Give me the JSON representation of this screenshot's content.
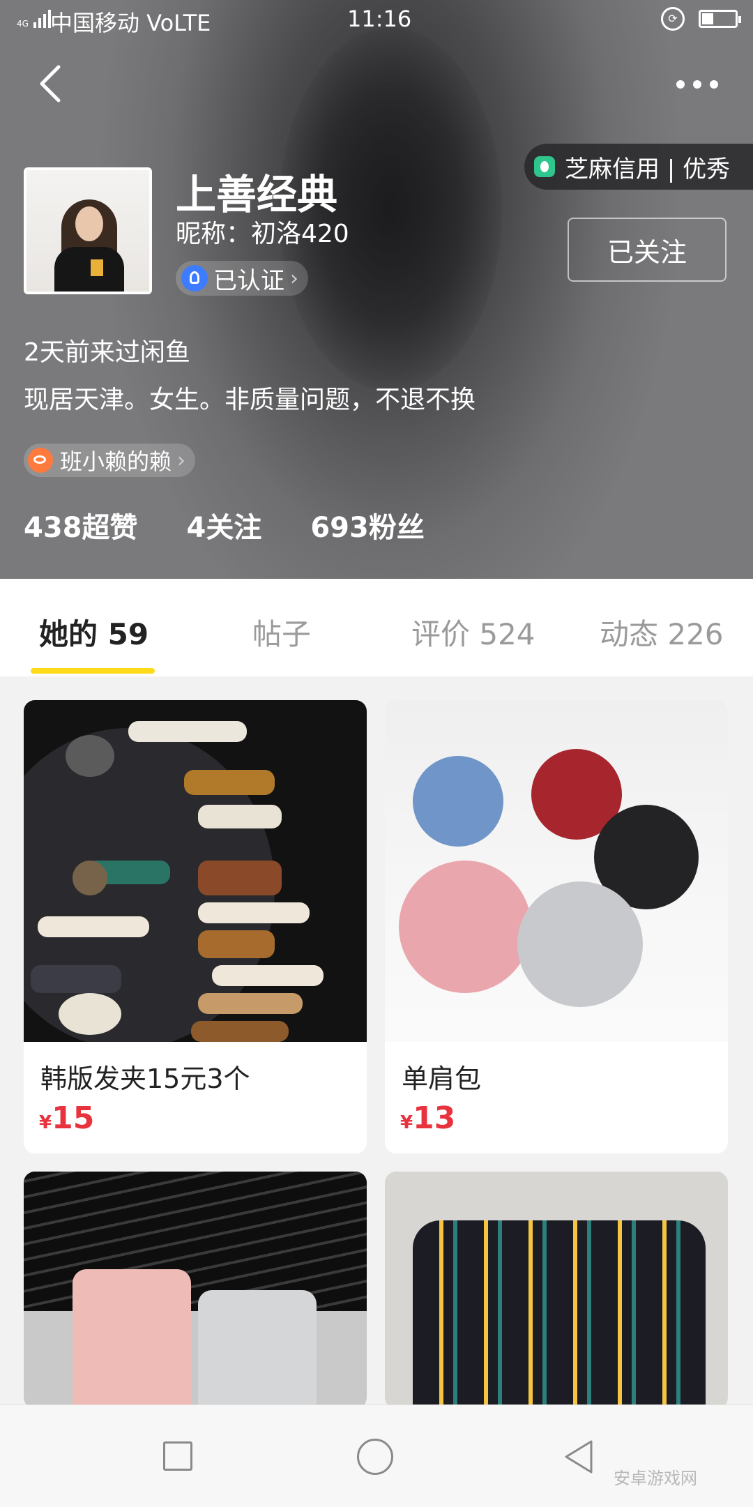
{
  "status_bar": {
    "signal": "4G",
    "carrier": "中国移动 VoLTE",
    "time": "11:16"
  },
  "header": {
    "credit": "芝麻信用 | 优秀",
    "shop_name": "上善经典",
    "nickname": "昵称：初洛420",
    "verified": "已认证",
    "follow_button": "已关注",
    "last_visit": "2天前来过闲鱼",
    "bio": "现居天津。女生。非质量问题，不退不换",
    "weibo": "班小赖的赖",
    "stats": [
      "438超赞",
      "4关注",
      "693粉丝"
    ]
  },
  "tabs": [
    {
      "label": "她的 59",
      "active": true
    },
    {
      "label": "帖子",
      "active": false
    },
    {
      "label": "评价 524",
      "active": false
    },
    {
      "label": "动态 226",
      "active": false
    }
  ],
  "items": [
    {
      "title": "韩版发夹15元3个",
      "currency": "¥",
      "price": "15"
    },
    {
      "title": "单肩包",
      "currency": "¥",
      "price": "13"
    },
    {
      "title": "",
      "currency": "",
      "price": ""
    },
    {
      "title": "",
      "currency": "",
      "price": ""
    }
  ],
  "colors": {
    "accent_yellow": "#ffda1a",
    "price_red": "#e8323d",
    "credit_green": "#2fc68d",
    "verified_blue": "#3d7bff",
    "weibo_orange": "#ff7a3d"
  },
  "watermark": "安卓游戏网"
}
